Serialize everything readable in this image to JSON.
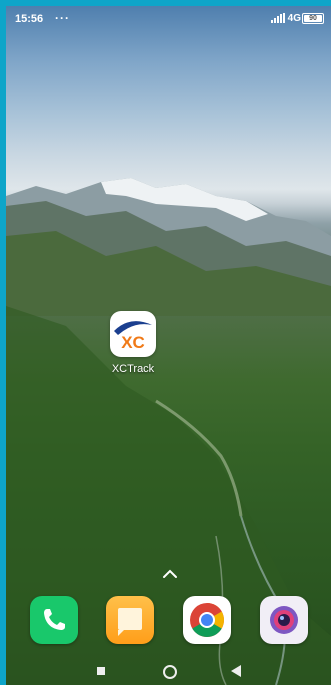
{
  "status_bar": {
    "time": "15:56",
    "dots": "···",
    "network": "4G",
    "battery_level": "90"
  },
  "home_apps": [
    {
      "label": "XCTrack",
      "icon": "xctrack-icon"
    }
  ],
  "dock_apps": [
    {
      "name": "phone",
      "icon": "phone-icon",
      "color": "#19c86b"
    },
    {
      "name": "notes",
      "icon": "notes-icon",
      "color": "#ffa726"
    },
    {
      "name": "chrome",
      "icon": "chrome-icon",
      "color": "#4285f4"
    },
    {
      "name": "camera",
      "icon": "camera-icon",
      "color": "#8e5fd6"
    }
  ],
  "nav_bar": {
    "recents": "recents-icon",
    "home": "home-icon",
    "back": "back-icon"
  }
}
